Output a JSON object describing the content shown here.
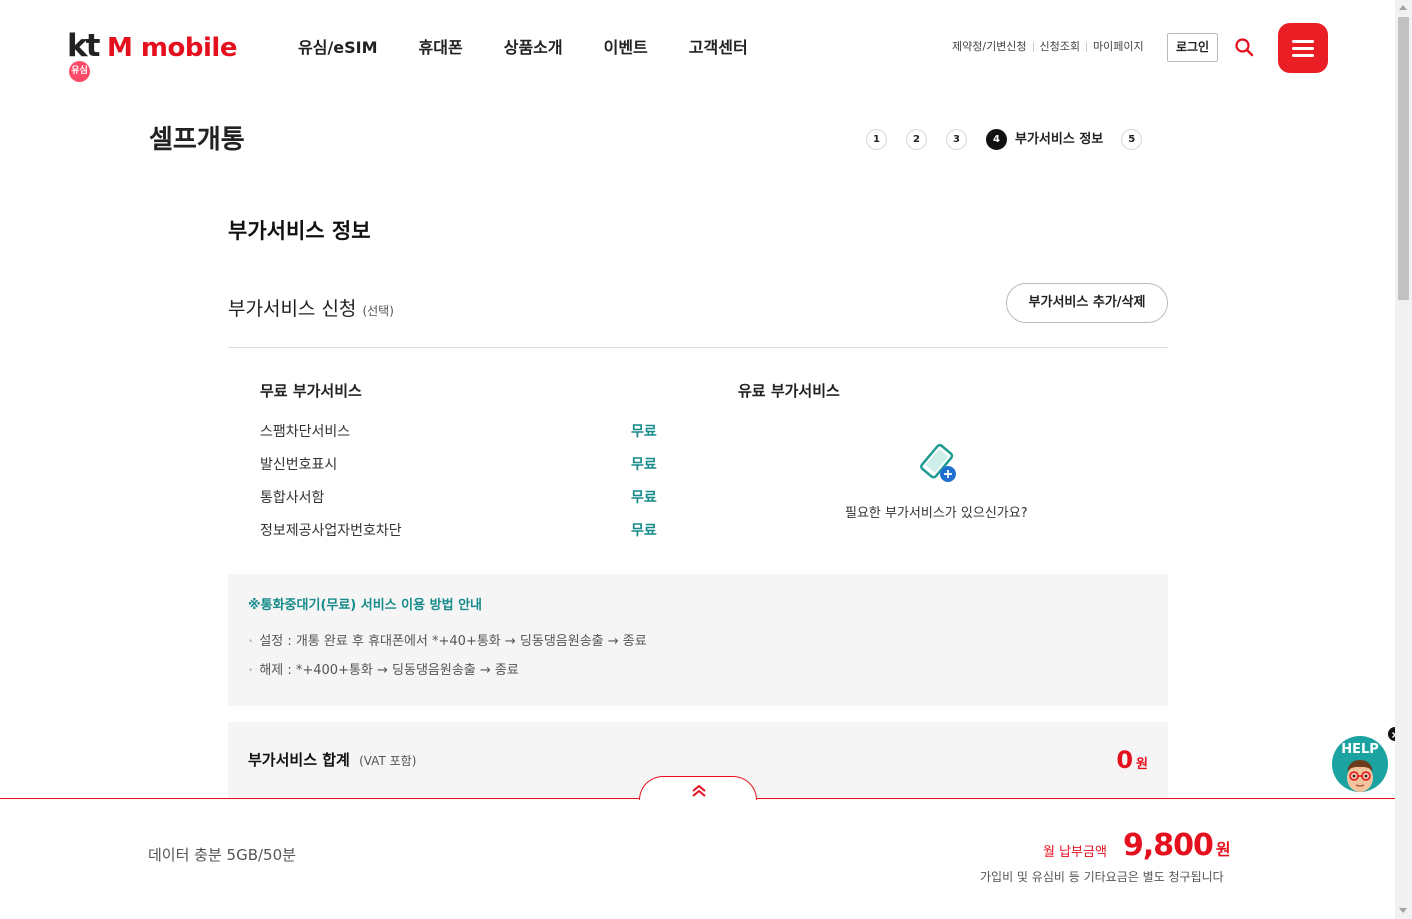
{
  "header": {
    "logo_kt": "kt",
    "logo_brand": "M mobile",
    "logo_badge": "유심",
    "nav": [
      "유심/eSIM",
      "휴대폰",
      "상품소개",
      "이벤트",
      "고객센터"
    ],
    "util_links": [
      "제약정/기변신청",
      "신청조회",
      "마이페이지"
    ],
    "login_label": "로그인"
  },
  "page": {
    "title": "셀프개통",
    "steps": [
      "1",
      "2",
      "3",
      "4",
      "5"
    ],
    "active_step_label": "부가서비스 정보"
  },
  "section": {
    "title": "부가서비스 정보",
    "subtitle": "부가서비스 신청",
    "subtitle_note": "(선택)",
    "add_remove_button": "부가서비스 추가/삭제",
    "free_title": "무료 부가서비스",
    "paid_title": "유료 부가서비스",
    "free_services": [
      {
        "name": "스팸차단서비스",
        "price": "무료"
      },
      {
        "name": "발신번호표시",
        "price": "무료"
      },
      {
        "name": "통합사서함",
        "price": "무료"
      },
      {
        "name": "정보제공사업자번호차단",
        "price": "무료"
      }
    ],
    "paid_empty_message": "필요한 부가서비스가 있으신가요?"
  },
  "info": {
    "title": "※통화중대기(무료) 서비스 이용 방법 안내",
    "lines": [
      "설정 : 개통 완료 후 휴대폰에서 *+40+통화 → 딩동댕음원송출 → 종료",
      "해제 : *+400+통화 → 딩동댕음원송출 → 종료"
    ]
  },
  "sum": {
    "label": "부가서비스 합계",
    "note": "(VAT 포함)",
    "value": "0",
    "unit": "원"
  },
  "bottom": {
    "plan_name": "데이터 충분 5GB/50분",
    "fee_label": "월 납부금액",
    "fee_value": "9,800",
    "fee_unit": "원",
    "fee_note": "가입비 및 유심비 등 기타요금은 별도 청구됩니다"
  },
  "help": {
    "label": "HELP"
  },
  "colors": {
    "brand_red": "#e5101e",
    "teal": "#168b8b",
    "help_teal": "#1aa3a0"
  }
}
